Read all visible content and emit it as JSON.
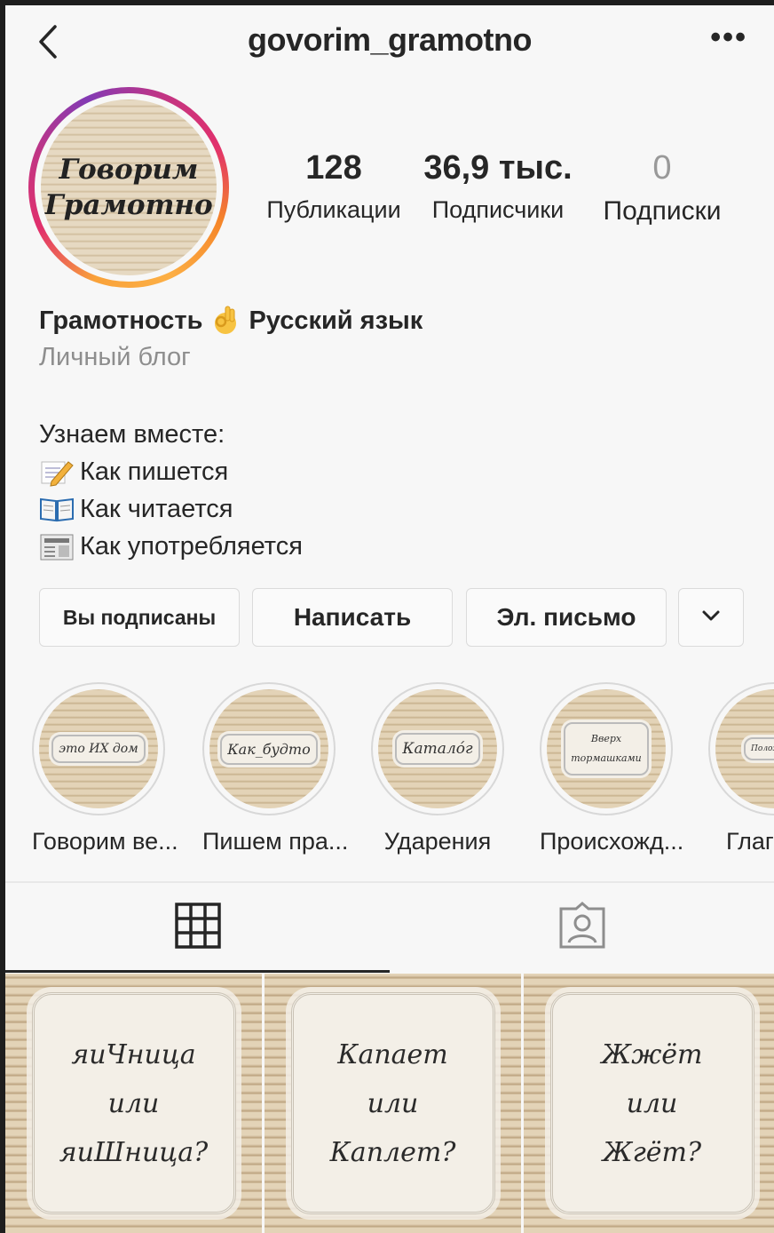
{
  "header": {
    "username": "govorim_gramotno",
    "more": "•••"
  },
  "avatar": {
    "line1": "Говорим",
    "line2": "Грамотно"
  },
  "stats": [
    {
      "value": "128",
      "label": "Публикации"
    },
    {
      "value": "36,9 тыс.",
      "label": "Подписчики"
    },
    {
      "value": "0",
      "label": "Подписки"
    }
  ],
  "bio": {
    "name_part1": "Грамотность",
    "name_part2": "Русский язык",
    "category": "Личный блог",
    "intro": "Узнаем вместе:",
    "lines": [
      {
        "icon": "memo-icon",
        "text": "Как пишется"
      },
      {
        "icon": "open-book-icon",
        "text": "Как читается"
      },
      {
        "icon": "newspaper-icon",
        "text": "Как употребляется"
      }
    ]
  },
  "buttons": {
    "following": "Вы подписаны",
    "message": "Написать",
    "email": "Эл. письмо"
  },
  "highlights": [
    {
      "cover": "это ИХ дом",
      "label": "Говорим ве..."
    },
    {
      "cover": "Как_будто",
      "label": "Пишем пра..."
    },
    {
      "cover": "Каталóг",
      "label": "Ударения"
    },
    {
      "cover": "Вверх тормашками",
      "label": "Происхожд..."
    },
    {
      "cover": "Положить",
      "label": "Глаг"
    }
  ],
  "tabs": {
    "active": "grid"
  },
  "posts": [
    {
      "l1": "яиЧница",
      "l2": "или",
      "l3": "яиШница?"
    },
    {
      "l1": "Капает",
      "l2": "или",
      "l3": "Каплет?"
    },
    {
      "l1": "Жжёт",
      "l2": "или",
      "l3": "Жгёт?"
    }
  ]
}
